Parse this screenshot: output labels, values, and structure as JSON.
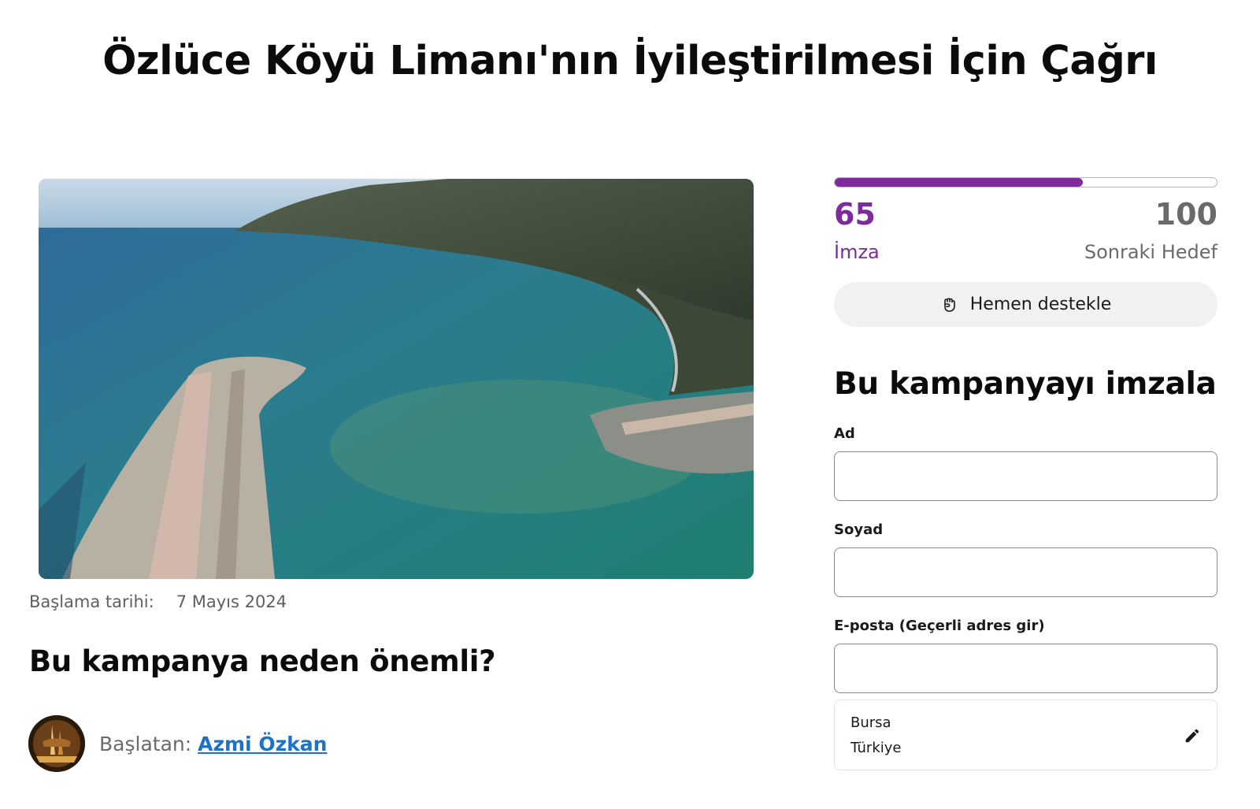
{
  "page": {
    "title": "Özlüce Köyü Limanı'nın İyileştirilmesi İçin Çağrı"
  },
  "campaign": {
    "start_label": "Başlama tarihi:",
    "start_date": "7 Mayıs 2024",
    "why_heading": "Bu kampanya neden önemli?",
    "starter_prefix": "Başlatan:",
    "starter_name": "Azmi Özkan"
  },
  "progress": {
    "signatures": "65",
    "signatures_label": "İmza",
    "goal": "100",
    "goal_label": "Sonraki Hedef",
    "fill_fraction": 0.65,
    "accent_color": "#7d2b9a"
  },
  "support_button": {
    "icon": "fist-icon",
    "label": "Hemen destekle"
  },
  "sign_form": {
    "heading": "Bu kampanyayı imzala",
    "first_name_label": "Ad",
    "first_name_value": "",
    "last_name_label": "Soyad",
    "last_name_value": "",
    "email_label": "E-posta (Geçerli adres gir)",
    "email_value": "",
    "location_city": "Bursa",
    "location_country": "Türkiye",
    "edit_icon": "pencil-icon"
  }
}
